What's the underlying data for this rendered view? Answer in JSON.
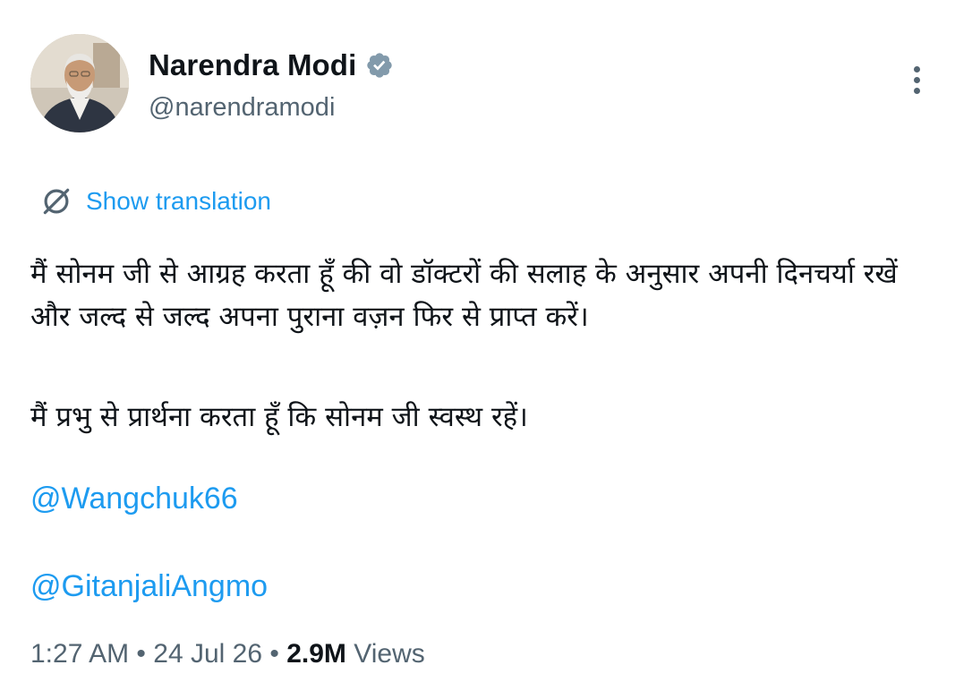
{
  "author": {
    "display_name": "Narendra Modi",
    "handle": "@narendramodi",
    "verified": true,
    "verified_badge_color": "#829aab"
  },
  "translation": {
    "label": "Show translation",
    "icon": "globe-translate-icon"
  },
  "tweet": {
    "paragraph_1": "मैं सोनम जी से आग्रह करता हूँ की वो डॉक्टरों की सलाह के अनुसार अपनी दिनचर्या रखें और जल्द से जल्द अपना पुराना वज़न फिर से प्राप्त करें।",
    "paragraph_2": "मैं प्रभु से प्रार्थना करता हूँ कि सोनम जी स्वस्थ रहें।",
    "mentions": [
      "@Wangchuk66",
      "@GitanjaliAngmo"
    ]
  },
  "meta": {
    "time": "1:27 AM",
    "separator": " • ",
    "date": "24 Jul 26",
    "views_count": "2.9M",
    "views_label": " Views"
  },
  "colors": {
    "link": "#1d9bf0",
    "secondary_text": "#536471",
    "primary_text": "#0f1419"
  }
}
